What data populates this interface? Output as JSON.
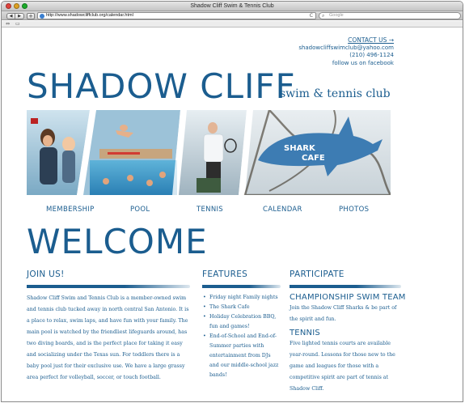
{
  "browser": {
    "window_title": "Shadow Cliff Swim & Tennis Club",
    "url": "http://www.shadowcliffclub.org/calendar.html",
    "search_placeholder": "Google",
    "back_glyph": "◀",
    "forward_glyph": "▶",
    "add_glyph": "+",
    "reload_glyph": "C",
    "search_glyph": "⌕",
    "bookmark_glyphs": [
      "⇔",
      "▭"
    ]
  },
  "contact": {
    "link_label": "CONTACT US →",
    "email": "shadowcliffswimclub@yahoo.com",
    "phone": "(210) 496-1124",
    "facebook": "follow us on facebook"
  },
  "logo": {
    "main": "SHADOW CLIFF",
    "tagline": "swim & tennis club"
  },
  "banner": {
    "cafe_sign_line1": "SHARK",
    "cafe_sign_line2": "CAFE"
  },
  "nav": {
    "items": [
      "MEMBERSHIP",
      "POOL",
      "TENNIS",
      "CALENDAR",
      "PHOTOS"
    ]
  },
  "welcome": "WELCOME",
  "join": {
    "heading": "JOIN US!",
    "body": "Shadow Cliff Swim and Tennis Club is a member-owned swim and tennis club tucked away in north central San Antonio. It is a place to relax, swim laps, and have fun with your family. The main pool is watched by the friendliest lifeguards around, has two diving boards, and is the perfect place for taking it easy and socializing under the Texas sun. For toddlers there is a baby pool just for their exclusive use. We have a large grassy area perfect for volleyball, soccer, or touch football."
  },
  "features": {
    "heading": "FEATURES",
    "items": [
      "Friday night Family nights",
      "The Shark Cafe",
      "Holiday Celebration BBQ, fun and games!",
      "End-of-School and End-of-Summer parties with entertainment from DJs and our middle-school jazz bands!"
    ]
  },
  "participate": {
    "heading": "PARTICIPATE",
    "swim_heading": "CHAMPIONSHIP SWIM TEAM",
    "swim_body": "Join the Shadow Cliff Sharks & be part of the spirit and fun.",
    "tennis_heading": "TENNIS",
    "tennis_body": "Five lighted tennis courts are available year-round. Lessons for those new to the game and leagues for those with a competitive spirit are part of tennis at Shadow Cliff."
  },
  "colors": {
    "brand_blue": "#1b5d8f"
  }
}
